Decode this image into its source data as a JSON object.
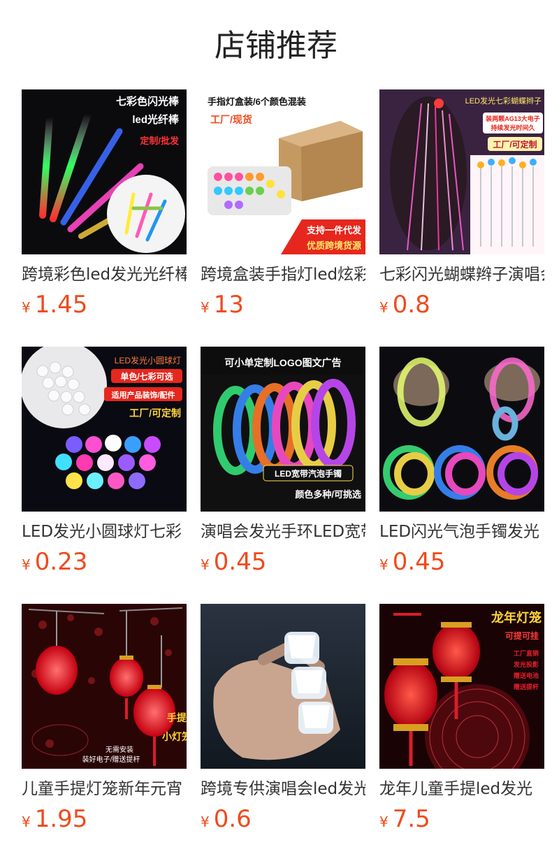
{
  "header": {
    "title": "店铺推荐"
  },
  "currency": "¥",
  "products": [
    {
      "name": "跨境彩色led发光光纤棒",
      "price": "1.45",
      "image_text": [
        "七彩色闪光棒",
        "led光纤棒",
        "定制/批发"
      ]
    },
    {
      "name": "跨境盒装手指灯led炫彩",
      "price": "13",
      "image_text": [
        "手指灯盒装/6个颜色混装",
        "工厂/现货",
        "支持一件代发",
        "优质跨境货源"
      ]
    },
    {
      "name": "七彩闪光蝴蝶辫子演唱会",
      "price": "0.8",
      "image_text": [
        "LED发光七彩蝴蝶辫子",
        "装两颗AG13大电子",
        "持续发光时间久",
        "工厂/可定制"
      ]
    },
    {
      "name": "LED发光小圆球灯七彩",
      "price": "0.23",
      "image_text": [
        "LED发光小圆球灯",
        "单色/七彩可选",
        "适用产品装饰/配件",
        "工厂/可定制"
      ]
    },
    {
      "name": "演唱会发光手环LED宽带",
      "price": "0.45",
      "image_text": [
        "可小单定制LOGO图文广告",
        "LED宽带汽泡手镯",
        "颜色多种/可挑选"
      ]
    },
    {
      "name": "LED闪光气泡手镯发光",
      "price": "0.45",
      "image_text": []
    },
    {
      "name": "儿童手提灯笼新年元宵",
      "price": "1.95",
      "image_text": [
        "手提",
        "小灯笼",
        "无需安装",
        "装好电子/赠送提杆"
      ]
    },
    {
      "name": "跨境专供演唱会led发光",
      "price": "0.6",
      "image_text": []
    },
    {
      "name": "龙年儿童手提led发光",
      "price": "7.5",
      "image_text": [
        "龙年灯笼",
        "可提可挂",
        "工厂直销",
        "发光投影",
        "赠送电池",
        "赠送提杆"
      ]
    }
  ]
}
